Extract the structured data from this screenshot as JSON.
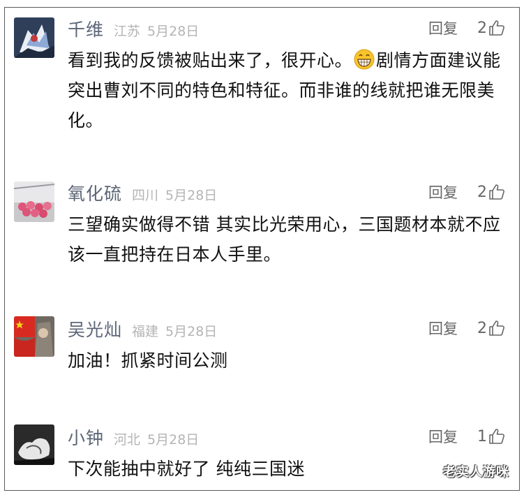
{
  "comments": [
    {
      "username": "千维",
      "location": "江苏",
      "date": "5月28日",
      "reply_label": "回复",
      "likes": "2",
      "text_before_emoji": "看到我的反馈被贴出来了，很开心。",
      "emoji": "grinning-face-icon",
      "text_after_emoji": "剧情方面建议能突出曹刘不同的特色和特征。而非谁的线就把谁无限美化。"
    },
    {
      "username": "氧化硫",
      "location": "四川",
      "date": "5月28日",
      "reply_label": "回复",
      "likes": "2",
      "text": "三望确实做得不错 其实比光荣用心，三国题材本就不应该一直把持在日本人手里。"
    },
    {
      "username": "吴光灿",
      "location": "福建",
      "date": "5月28日",
      "reply_label": "回复",
      "likes": "2",
      "text": "加油！抓紧时间公测"
    },
    {
      "username": "小钟",
      "location": "河北",
      "date": "5月28日",
      "reply_label": "回复",
      "likes": "1",
      "text": "下次能抽中就好了 纯纯三国迷"
    }
  ],
  "watermark": "老实人游咪",
  "colors": {
    "username": "#5d6677",
    "meta": "#b4b4b4",
    "text": "#111111",
    "border": "#5a5a5a"
  }
}
